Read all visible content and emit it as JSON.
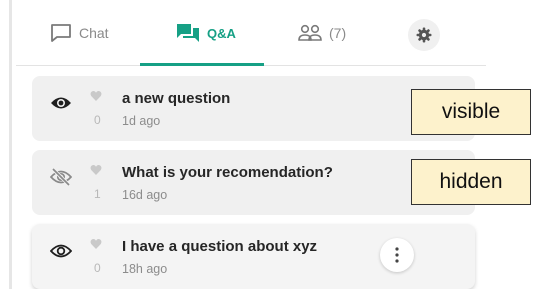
{
  "tabs": {
    "chat_label": "Chat",
    "qa_label": "Q&A",
    "people_label": "(7)",
    "accent_color": "#16a085"
  },
  "questions": [
    {
      "title": "a new question",
      "time": "1d ago",
      "likes": "0",
      "visibility": "visible",
      "visibility_icon": "eye-icon"
    },
    {
      "title": "What is your recomendation?",
      "time": "16d ago",
      "likes": "1",
      "visibility": "hidden",
      "visibility_icon": "eye-slash-icon"
    },
    {
      "title": "I have a question about xyz",
      "time": "18h ago",
      "likes": "0",
      "visibility": "visible",
      "visibility_icon": "eye-outline-icon"
    }
  ],
  "callouts": {
    "visible_label": "visible",
    "hidden_label": "hidden"
  }
}
